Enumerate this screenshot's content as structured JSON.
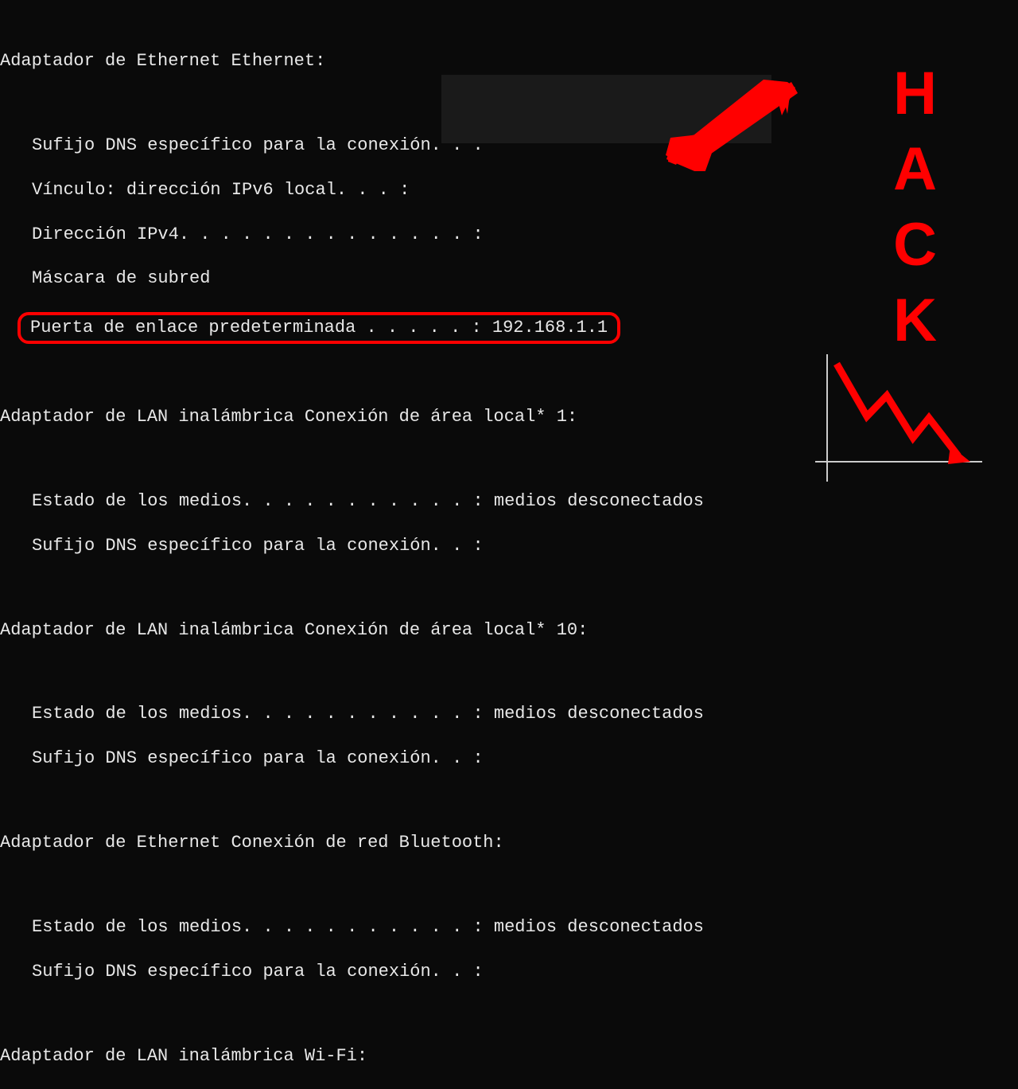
{
  "adapters": {
    "ethernet": {
      "header": "Adaptador de Ethernet Ethernet:",
      "dns_suffix": "Sufijo DNS específico para la conexión. . :",
      "ipv6_link": "Vínculo: dirección IPv6 local. . . :",
      "ipv4": "Dirección IPv4. . . . . . . . . . . . . . :",
      "subnet": "Máscara de subred",
      "gateway_label": "Puerta de enlace predeterminada . . . . . :",
      "gateway_value": "192.168.1.1"
    },
    "wlan1": {
      "header": "Adaptador de LAN inalámbrica Conexión de área local* 1:",
      "media_state": "Estado de los medios. . . . . . . . . . . : medios desconectados",
      "dns_suffix": "Sufijo DNS específico para la conexión. . :"
    },
    "wlan10": {
      "header": "Adaptador de LAN inalámbrica Conexión de área local* 10:",
      "media_state": "Estado de los medios. . . . . . . . . . . : medios desconectados",
      "dns_suffix": "Sufijo DNS específico para la conexión. . :"
    },
    "bluetooth": {
      "header": "Adaptador de Ethernet Conexión de red Bluetooth:",
      "media_state": "Estado de los medios. . . . . . . . . . . : medios desconectados",
      "dns_suffix": "Sufijo DNS específico para la conexión. . :"
    },
    "wifi": {
      "header": "Adaptador de LAN inalámbrica Wi-Fi:"
    }
  },
  "overlay": {
    "hack_letters": [
      "H",
      "A",
      "C",
      "K"
    ]
  },
  "colors": {
    "accent": "#ff0000",
    "bg": "#0a0a0a",
    "text": "#e8e8e8"
  }
}
